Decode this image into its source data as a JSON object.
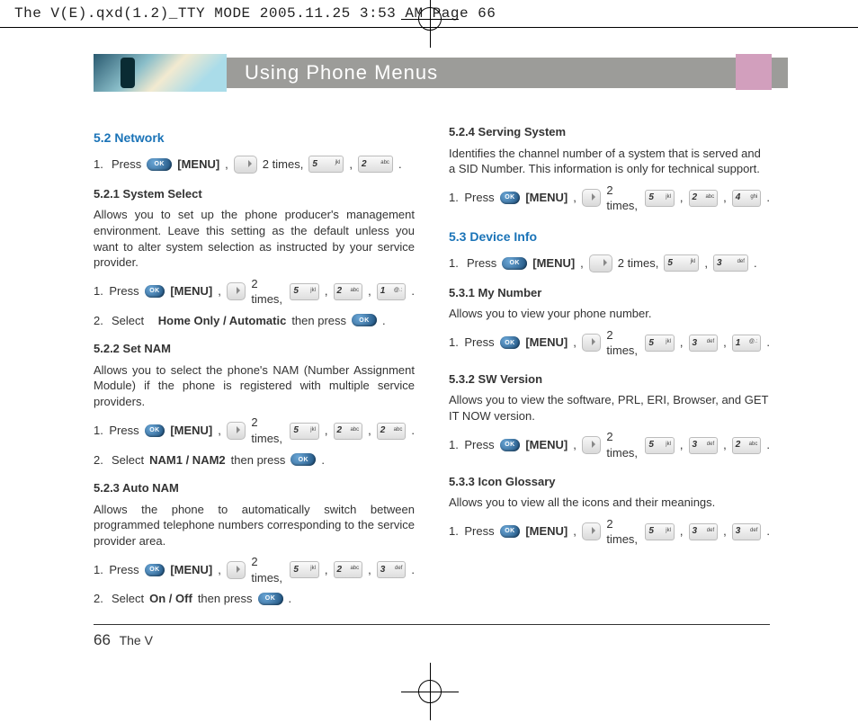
{
  "print_header": "The V(E).qxd(1.2)_TTY MODE  2005.11.25  3:53 AM  Page 66",
  "chapter_title": "Using Phone Menus",
  "keys": {
    "ok": "OK",
    "k1": {
      "d": "1",
      "s": "@.:"
    },
    "k2": {
      "d": "2",
      "s": "abc"
    },
    "k3": {
      "d": "3",
      "s": "def"
    },
    "k4": {
      "d": "4",
      "s": "ghi"
    },
    "k5": {
      "d": "5",
      "s": "jkl"
    }
  },
  "words": {
    "press": "Press",
    "menu": "[MENU]",
    "two_times": "2 times,",
    "select": "Select",
    "then_press": "then press"
  },
  "L": {
    "s52_title": "5.2 Network",
    "s521_title": "5.2.1 System Select",
    "s521_body": "Allows you to set up the phone producer's management environment. Leave this setting as the default unless you want to alter system selection as instructed by your service provider.",
    "s521_sel": "Home Only / Automatic",
    "s522_title": "5.2.2 Set NAM",
    "s522_body": "Allows you to select the phone's NAM (Number Assignment Module) if the phone is registered with multiple service providers.",
    "s522_sel": "NAM1 / NAM2",
    "s523_title": "5.2.3 Auto NAM",
    "s523_body": "Allows the phone to automatically switch between programmed telephone numbers corresponding to the service provider area.",
    "s523_sel": "On / Off"
  },
  "R": {
    "s524_title": "5.2.4 Serving System",
    "s524_body": "Identifies the channel number of a system that is served and a SID Number. This information is only for technical support.",
    "s53_title": "5.3 Device Info",
    "s531_title": "5.3.1 My Number",
    "s531_body": "Allows you to view your phone number.",
    "s532_title": "5.3.2 SW Version",
    "s532_body": "Allows you to view the software, PRL, ERI, Browser, and GET IT NOW version.",
    "s533_title": "5.3.3 Icon Glossary",
    "s533_body": "Allows you to view all the icons and their meanings."
  },
  "footer": {
    "page": "66",
    "book": "The V"
  }
}
